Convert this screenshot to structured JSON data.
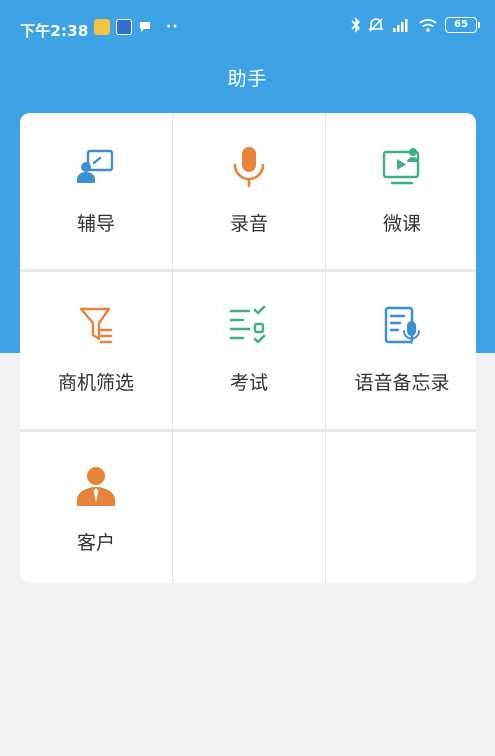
{
  "status_bar": {
    "time": "下午2:38",
    "battery": "65",
    "icons": [
      "notification-app-yellow",
      "notification-app-blue",
      "bluetooth-icon",
      "mute-icon",
      "signal-icon",
      "wifi-icon",
      "battery-icon"
    ],
    "dots": "··"
  },
  "header": {
    "title": "助手"
  },
  "colors": {
    "accent": "#3ea3e6",
    "blue_icon": "#3b8fd4",
    "orange_icon": "#e8843a",
    "green_icon": "#3fae8f"
  },
  "tiles": [
    {
      "label": "辅导",
      "icon": "tutoring-board-icon"
    },
    {
      "label": "录音",
      "icon": "microphone-icon"
    },
    {
      "label": "微课",
      "icon": "video-lesson-icon"
    },
    {
      "label": "商机筛选",
      "icon": "funnel-filter-icon"
    },
    {
      "label": "考试",
      "icon": "exam-checklist-icon"
    },
    {
      "label": "语音备忘录",
      "icon": "voice-memo-icon"
    },
    {
      "label": "客户",
      "icon": "customer-person-icon"
    }
  ]
}
